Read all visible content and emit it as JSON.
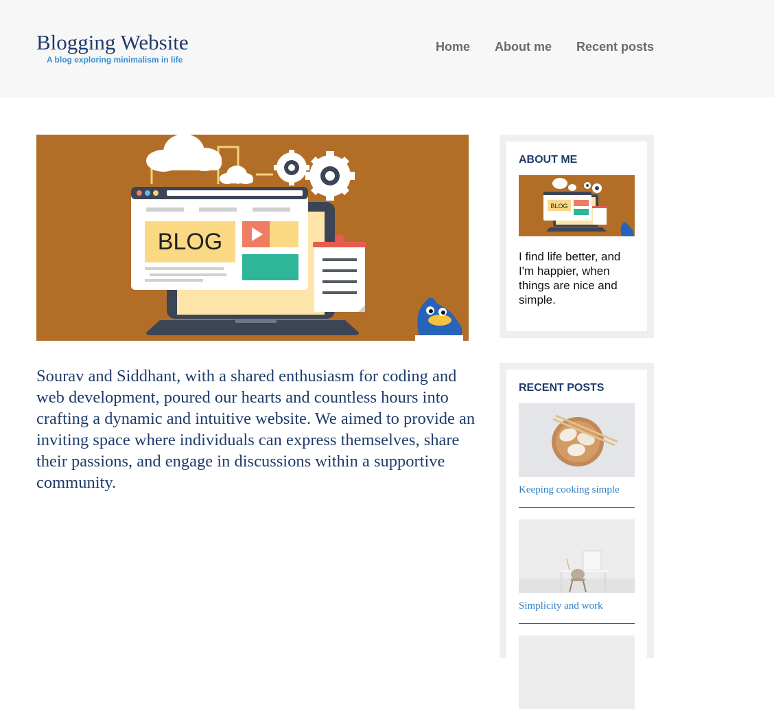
{
  "header": {
    "title": "Blogging Website",
    "tagline": "A blog exploring minimalism in life",
    "nav": [
      {
        "label": "Home"
      },
      {
        "label": "About me"
      },
      {
        "label": "Recent posts"
      }
    ]
  },
  "hero": {
    "blog_label": "BLOG"
  },
  "main": {
    "intro": "Sourav and Siddhant, with a shared enthusiasm for coding and web development, poured our hearts and countless hours into crafting a dynamic and intuitive website. We aimed to provide an inviting space where individuals can express themselves, share their passions, and engage in discussions within a supportive community."
  },
  "sidebar": {
    "about": {
      "title": "ABOUT ME",
      "thumb_label": "BLOG",
      "text": "I find life better, and I'm happier, when things are nice and simple."
    },
    "recent": {
      "title": "RECENT POSTS",
      "posts": [
        {
          "title": "Keeping cooking simple"
        },
        {
          "title": "Simplicity and work"
        }
      ]
    }
  },
  "colors": {
    "header_bg": "#f7f7f7",
    "title": "#1f3b6b",
    "link": "#2f7fc4",
    "hero_bg": "#b26e27",
    "widget_frame": "#efefef"
  }
}
